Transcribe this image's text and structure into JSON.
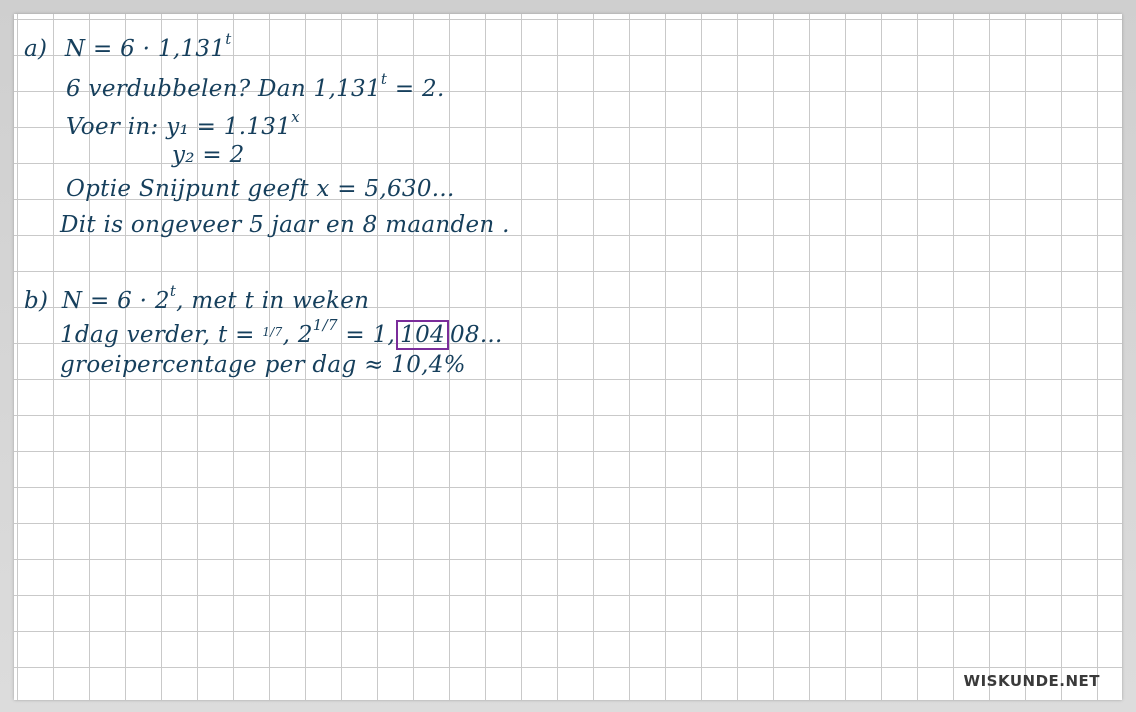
{
  "part_a": {
    "label": "a)",
    "l1_formula": "N = 6 · 1,131",
    "l1_exp": "t",
    "l2_text": "6 verdubbelen?  Dan  1,131",
    "l2_exp": "t",
    "l2_end": " = 2.",
    "l3_text": "Voer in:  y₁ = 1.131",
    "l3_exp": "x",
    "l4_text": "y₂ = 2",
    "l5_text": "Optie Snijpunt geeft x = 5,630...",
    "l6_text": "Dit is ongeveer  5  jaar  en  8  maanden ."
  },
  "part_b": {
    "label": "b)",
    "l1_formula": "N = 6 · 2",
    "l1_exp": "t",
    "l1_end": ", met t in weken",
    "l2_start": "1dag verder,  t = ",
    "l2_frac": "1/7",
    "l2_mid": ",  2",
    "l2_exp": "1/7",
    "l2_eq": " = 1,",
    "l2_boxed": "104",
    "l2_end": "08...",
    "l3_text": "groeipercentage per dag ≈ 10,4%"
  },
  "brand": "WISKUNDE.NET"
}
